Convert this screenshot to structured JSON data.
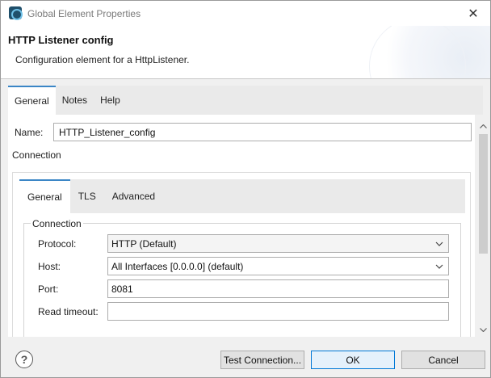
{
  "window": {
    "title": "Global Element Properties",
    "close_glyph": "✕"
  },
  "header": {
    "title": "HTTP Listener config",
    "description": "Configuration element for a HttpListener."
  },
  "tabs": [
    {
      "label": "General",
      "active": true
    },
    {
      "label": "Notes",
      "active": false
    },
    {
      "label": "Help",
      "active": false
    }
  ],
  "name_field": {
    "label": "Name:",
    "value": "HTTP_Listener_config"
  },
  "connection_section": {
    "label": "Connection",
    "inner_tabs": [
      {
        "label": "General",
        "active": true
      },
      {
        "label": "TLS",
        "active": false
      },
      {
        "label": "Advanced",
        "active": false
      }
    ],
    "group_label": "Connection",
    "fields": {
      "protocol": {
        "label": "Protocol:",
        "value": "HTTP (Default)"
      },
      "host": {
        "label": "Host:",
        "value": "All Interfaces [0.0.0.0] (default)"
      },
      "port": {
        "label": "Port:",
        "value": "8081"
      },
      "read_timeout": {
        "label": "Read timeout:",
        "value": ""
      }
    }
  },
  "footer": {
    "help_glyph": "?",
    "test_connection_label": "Test Connection...",
    "ok_label": "OK",
    "cancel_label": "Cancel"
  },
  "colors": {
    "accent": "#3b86c6",
    "primary_button_border": "#0078d7"
  }
}
